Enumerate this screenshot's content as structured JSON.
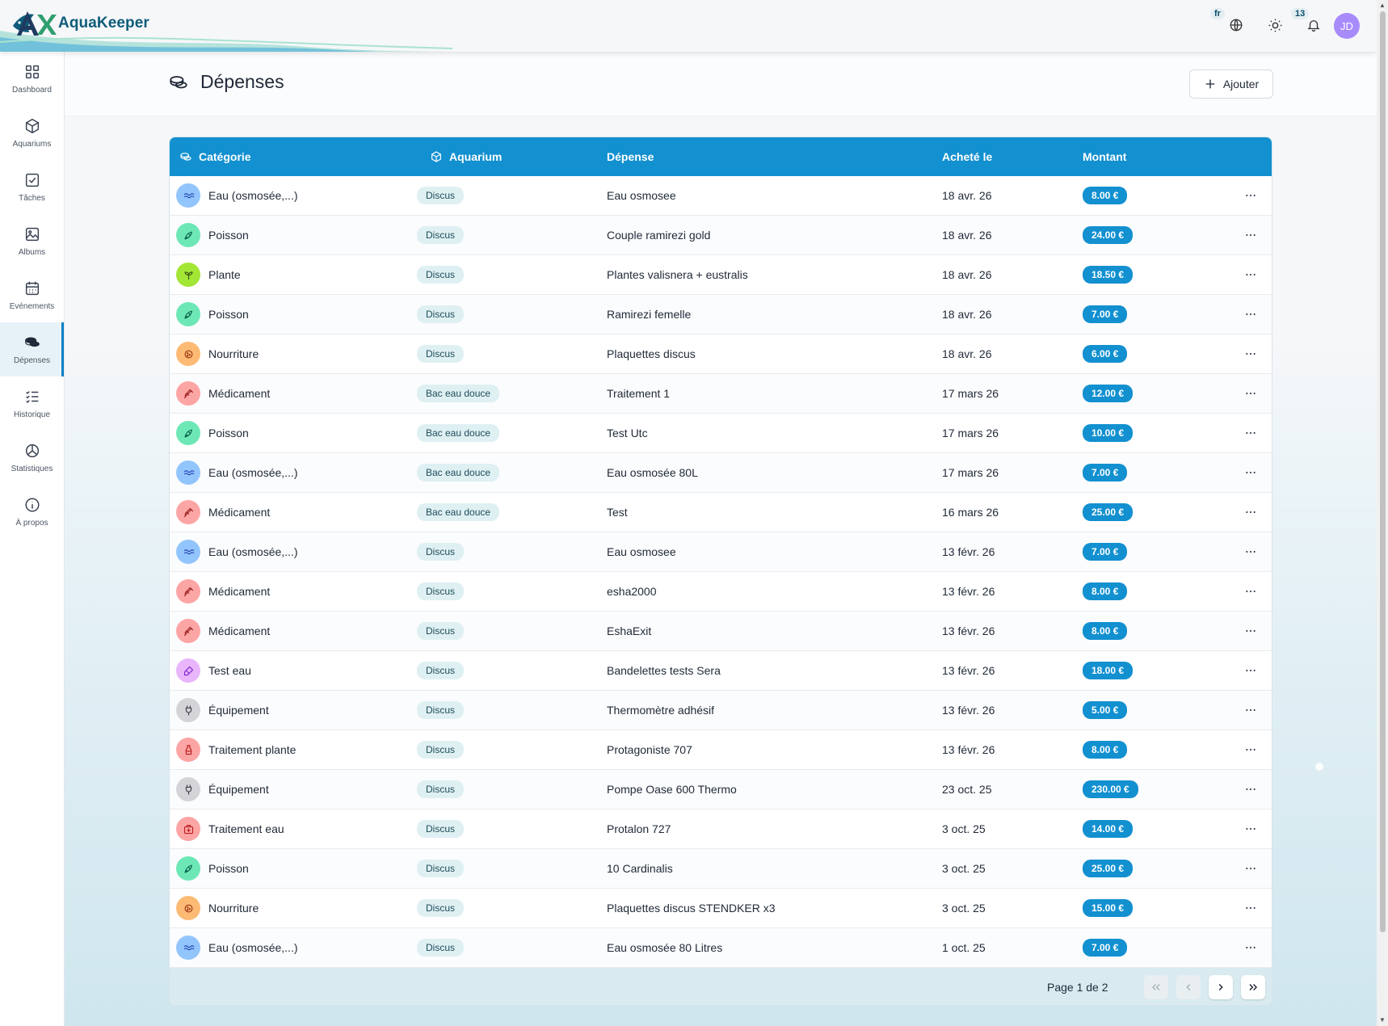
{
  "app": {
    "name": "AquaKeeper",
    "language": "fr",
    "notifications": "13",
    "user_initials": "JD"
  },
  "sidebar": {
    "items": [
      {
        "label": "Dashboard",
        "icon": "grid-icon"
      },
      {
        "label": "Aquariums",
        "icon": "cube-icon"
      },
      {
        "label": "Tâches",
        "icon": "checkbox-icon"
      },
      {
        "label": "Albums",
        "icon": "image-icon"
      },
      {
        "label": "Evénements",
        "icon": "calendar-icon"
      },
      {
        "label": "Dépenses",
        "icon": "coins-icon",
        "active": true
      },
      {
        "label": "Historique",
        "icon": "list-check-icon"
      },
      {
        "label": "Statistiques",
        "icon": "pie-chart-icon"
      },
      {
        "label": "À propos",
        "icon": "info-icon"
      }
    ]
  },
  "page": {
    "title": "Dépenses",
    "add_label": "Ajouter"
  },
  "table": {
    "headers": {
      "category": "Catégorie",
      "aquarium": "Aquarium",
      "expense": "Dépense",
      "date": "Acheté le",
      "amount": "Montant"
    },
    "rows": [
      {
        "category": "Eau (osmosée,...)",
        "cat": "water",
        "aquarium": "Discus",
        "expense": "Eau osmosee",
        "date": "18 avr. 26",
        "amount": "8.00 €"
      },
      {
        "category": "Poisson",
        "cat": "fish",
        "aquarium": "Discus",
        "expense": "Couple ramirezi gold",
        "date": "18 avr. 26",
        "amount": "24.00 €"
      },
      {
        "category": "Plante",
        "cat": "plant",
        "aquarium": "Discus",
        "expense": "Plantes valisnera + eustralis",
        "date": "18 avr. 26",
        "amount": "18.50 €"
      },
      {
        "category": "Poisson",
        "cat": "fish",
        "aquarium": "Discus",
        "expense": "Ramirezi femelle",
        "date": "18 avr. 26",
        "amount": "7.00 €"
      },
      {
        "category": "Nourriture",
        "cat": "food",
        "aquarium": "Discus",
        "expense": "Plaquettes discus",
        "date": "18 avr. 26",
        "amount": "6.00 €"
      },
      {
        "category": "Médicament",
        "cat": "medicine",
        "aquarium": "Bac eau douce",
        "expense": "Traitement 1",
        "date": "17 mars 26",
        "amount": "12.00 €"
      },
      {
        "category": "Poisson",
        "cat": "fish",
        "aquarium": "Bac eau douce",
        "expense": "Test Utc",
        "date": "17 mars 26",
        "amount": "10.00 €"
      },
      {
        "category": "Eau (osmosée,...)",
        "cat": "water",
        "aquarium": "Bac eau douce",
        "expense": "Eau osmosée 80L",
        "date": "17 mars 26",
        "amount": "7.00 €"
      },
      {
        "category": "Médicament",
        "cat": "medicine",
        "aquarium": "Bac eau douce",
        "expense": "Test",
        "date": "16 mars 26",
        "amount": "25.00 €"
      },
      {
        "category": "Eau (osmosée,...)",
        "cat": "water",
        "aquarium": "Discus",
        "expense": "Eau osmosee",
        "date": "13 févr. 26",
        "amount": "7.00 €"
      },
      {
        "category": "Médicament",
        "cat": "medicine",
        "aquarium": "Discus",
        "expense": "esha2000",
        "date": "13 févr. 26",
        "amount": "8.00 €"
      },
      {
        "category": "Médicament",
        "cat": "medicine",
        "aquarium": "Discus",
        "expense": "EshaExit",
        "date": "13 févr. 26",
        "amount": "8.00 €"
      },
      {
        "category": "Test eau",
        "cat": "test",
        "aquarium": "Discus",
        "expense": "Bandelettes tests Sera",
        "date": "13 févr. 26",
        "amount": "18.00 €"
      },
      {
        "category": "Équipement",
        "cat": "equipment",
        "aquarium": "Discus",
        "expense": "Thermomètre adhésif",
        "date": "13 févr. 26",
        "amount": "5.00 €"
      },
      {
        "category": "Traitement plante",
        "cat": "plant-treatment",
        "aquarium": "Discus",
        "expense": "Protagoniste 707",
        "date": "13 févr. 26",
        "amount": "8.00 €"
      },
      {
        "category": "Équipement",
        "cat": "equipment",
        "aquarium": "Discus",
        "expense": "Pompe Oase 600 Thermo",
        "date": "23 oct. 25",
        "amount": "230.00 €"
      },
      {
        "category": "Traitement eau",
        "cat": "water-treatment",
        "aquarium": "Discus",
        "expense": "Protalon 727",
        "date": "3 oct. 25",
        "amount": "14.00 €"
      },
      {
        "category": "Poisson",
        "cat": "fish",
        "aquarium": "Discus",
        "expense": "10 Cardinalis",
        "date": "3 oct. 25",
        "amount": "25.00 €"
      },
      {
        "category": "Nourriture",
        "cat": "food",
        "aquarium": "Discus",
        "expense": "Plaquettes discus STENDKER x3",
        "date": "3 oct. 25",
        "amount": "15.00 €"
      },
      {
        "category": "Eau (osmosée,...)",
        "cat": "water",
        "aquarium": "Discus",
        "expense": "Eau osmosée 80 Litres",
        "date": "1 oct. 25",
        "amount": "7.00 €"
      }
    ],
    "pagination": {
      "label": "Page 1 de 2"
    }
  },
  "category_colors": {
    "water": {
      "bg": "#93c5fd",
      "fg": "#1e40af"
    },
    "fish": {
      "bg": "#6ee7b7",
      "fg": "#065f46"
    },
    "plant": {
      "bg": "#a3e635",
      "fg": "#365314"
    },
    "food": {
      "bg": "#fdba74",
      "fg": "#9a3412"
    },
    "medicine": {
      "bg": "#fca5a5",
      "fg": "#991b1b"
    },
    "test": {
      "bg": "#e9b5fb",
      "fg": "#7e22ce"
    },
    "equipment": {
      "bg": "#d4d4d8",
      "fg": "#3f3f46"
    },
    "plant-treatment": {
      "bg": "#fca5a5",
      "fg": "#b91c1c"
    },
    "water-treatment": {
      "bg": "#fca5a5",
      "fg": "#b91c1c"
    }
  },
  "accent_color": "#1290d0"
}
